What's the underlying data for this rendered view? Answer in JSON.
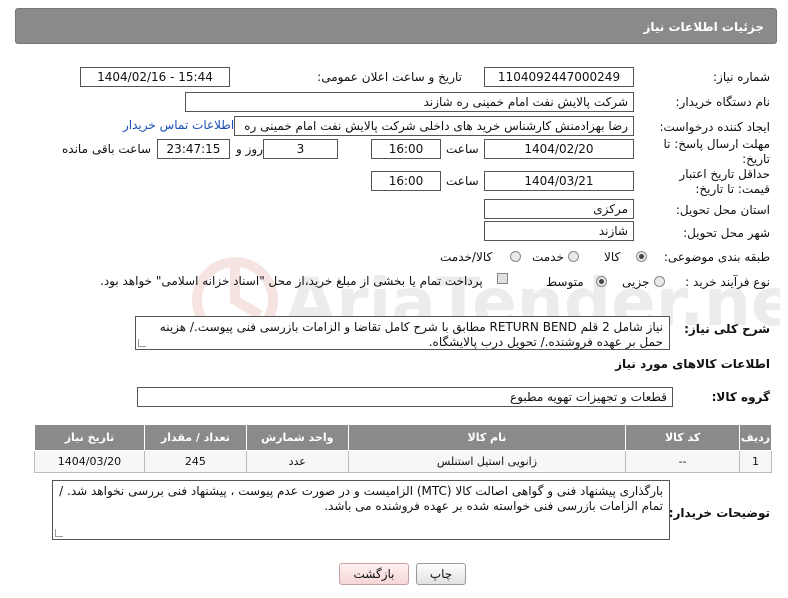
{
  "header": {
    "title": "جزئیات اطلاعات نیاز"
  },
  "form": {
    "need_number_label": "شماره نیاز:",
    "need_number": "1104092447000249",
    "announce_label": "تاریخ و ساعت اعلان عمومی:",
    "announce_value": "1404/02/16 - 15:44",
    "buyer_org_label": "نام دستگاه خریدار:",
    "buyer_org": "شرکت پالایش نفت امام خمینی  ره  شازند",
    "creator_label": "ایجاد کننده درخواست:",
    "creator": "رضا بهزادمنش کارشناس خرید های داخلی  شرکت پالایش نفت امام خمینی  ره",
    "buyer_contact_link": "اطلاعات تماس خریدار",
    "reply_deadline_label": "مهلت ارسال پاسخ: تا تاریخ:",
    "reply_date": "1404/02/20",
    "time_label": "ساعت",
    "reply_time": "16:00",
    "days_value": "3",
    "days_label": "روز و",
    "remaining_time": "23:47:15",
    "remaining_label": "ساعت باقی مانده",
    "price_validity_label": "حداقل تاریخ اعتبار قیمت: تا تاریخ:",
    "validity_date": "1404/03/21",
    "validity_time": "16:00",
    "province_label": "استان محل تحویل:",
    "province": "مرکزی",
    "city_label": "شهر محل تحویل:",
    "city": "شازند",
    "category_label": "طبقه بندی موضوعی:",
    "category_options": [
      "کالا",
      "خدمت",
      "کالا/خدمت"
    ],
    "process_label": "نوع فرآیند خرید :",
    "process_options": [
      "جزیی",
      "متوسط"
    ],
    "payment_note": "پرداخت تمام یا بخشی از مبلغ خرید،از محل \"اسناد خزانه اسلامی\" خواهد بود.",
    "description_label": "شرح کلی نیاز:",
    "description": "نیاز شامل 2 قلم RETURN BEND مطابق با شرح کامل تقاضا و الزامات بازرسی فنی پیوست./ هزینه حمل بر عهده فروشنده./ تحویل درب پالایشگاه."
  },
  "goods_section": {
    "title": "اطلاعات کالاهای مورد نیاز",
    "group_label": "گروه کالا:",
    "group_value": "قطعات و تجهیزات تهویه مطبوع"
  },
  "table": {
    "headers": [
      "ردیف",
      "کد کالا",
      "نام کالا",
      "واحد شمارش",
      "تعداد / مقدار",
      "تاریخ نیاز"
    ],
    "rows": [
      [
        "1",
        "--",
        "زانویی استیل استنلس",
        "عدد",
        "245",
        "1404/03/20"
      ]
    ]
  },
  "buyer_notes": {
    "label": "توضیحات خریدار:",
    "text": "بارگذاری پیشنهاد فنی و گواهی اصالت کالا (MTC) الزامیست و در صورت عدم پیوست ، پیشنهاد فنی بررسی نخواهد شد. / تمام الزامات بازرسی فنی خواسته شده بر عهده فروشنده می باشد."
  },
  "buttons": {
    "print": "چاپ",
    "back": "بازگشت"
  },
  "watermark": {
    "text": "AriaTender.neT"
  }
}
